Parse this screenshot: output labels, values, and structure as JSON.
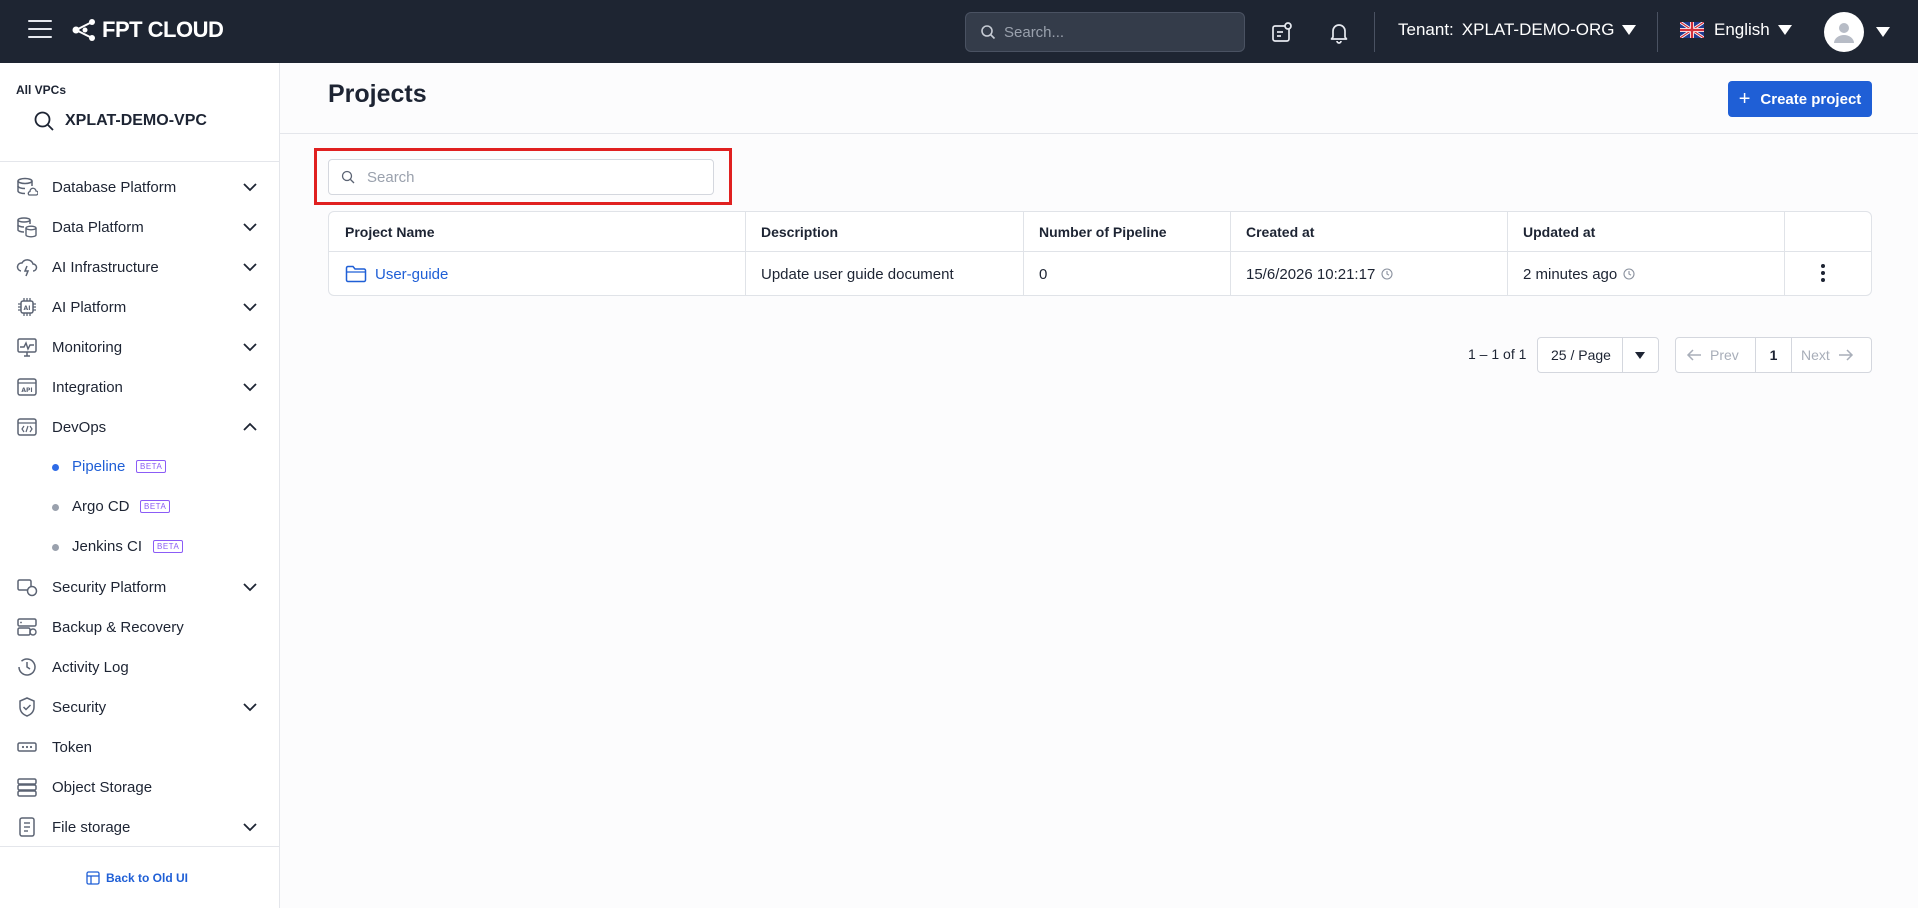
{
  "topbar": {
    "brand": "FPT CLOUD",
    "search_placeholder": "Search...",
    "tenant_label": "Tenant:",
    "tenant_value": "XPLAT-DEMO-ORG",
    "language": "English"
  },
  "sidebar": {
    "vpc_caption": "All VPCs",
    "vpc_name": "XPLAT-DEMO-VPC",
    "items": [
      {
        "label": "Database Platform",
        "icon": "database-cloud-icon",
        "expandable": true
      },
      {
        "label": "Data Platform",
        "icon": "data-stack-icon",
        "expandable": true
      },
      {
        "label": "AI Infrastructure",
        "icon": "ai-infrastructure-icon",
        "expandable": true
      },
      {
        "label": "AI Platform",
        "icon": "ai-chip-icon",
        "expandable": true
      },
      {
        "label": "Monitoring",
        "icon": "monitor-chart-icon",
        "expandable": true
      },
      {
        "label": "Integration",
        "icon": "api-icon",
        "expandable": true
      },
      {
        "label": "DevOps",
        "icon": "code-window-icon",
        "expandable": true,
        "expanded": true
      }
    ],
    "devops_children": [
      {
        "label": "Pipeline",
        "badge": "BETA",
        "active": true
      },
      {
        "label": "Argo CD",
        "badge": "BETA",
        "active": false
      },
      {
        "label": "Jenkins CI",
        "badge": "BETA",
        "active": false
      }
    ],
    "items_after": [
      {
        "label": "Security Platform",
        "icon": "security-platform-icon",
        "expandable": true
      },
      {
        "label": "Backup & Recovery",
        "icon": "backup-icon",
        "expandable": false
      },
      {
        "label": "Activity Log",
        "icon": "clock-history-icon",
        "expandable": false
      },
      {
        "label": "Security",
        "icon": "shield-icon",
        "expandable": true
      },
      {
        "label": "Token",
        "icon": "token-icon",
        "expandable": false
      },
      {
        "label": "Object Storage",
        "icon": "storage-icon",
        "expandable": false
      },
      {
        "label": "File storage",
        "icon": "file-storage-icon",
        "expandable": true
      }
    ],
    "back_link": "Back to Old UI"
  },
  "main": {
    "title": "Projects",
    "create_button": "Create project",
    "search_placeholder": "Search",
    "table": {
      "columns": [
        "Project Name",
        "Description",
        "Number of Pipeline",
        "Created at",
        "Updated at"
      ],
      "rows": [
        {
          "name": "User-guide",
          "description": "Update user guide document",
          "pipelines": "0",
          "created": "15/6/2026 10:21:17",
          "updated": "2 minutes ago"
        }
      ]
    },
    "pagination": {
      "summary": "1 – 1 of 1",
      "page_size": "25 / Page",
      "prev": "Prev",
      "current": "1",
      "next": "Next"
    }
  },
  "colors": {
    "topbar_bg": "#1e2532",
    "accent": "#1f5fd6",
    "beta": "#8b5cf6",
    "highlight": "#e02020"
  }
}
